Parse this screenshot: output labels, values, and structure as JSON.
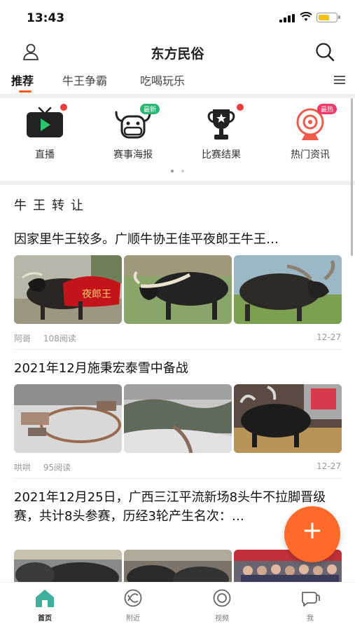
{
  "status_bar": {
    "time": "13:43"
  },
  "header": {
    "title": "东方民俗",
    "user_icon": "user-icon",
    "search_icon": "search-icon"
  },
  "tabs": [
    {
      "label": "推荐",
      "active": true
    },
    {
      "label": "牛王争霸",
      "active": false
    },
    {
      "label": "吃喝玩乐",
      "active": false
    }
  ],
  "quick_actions": [
    {
      "label": "直播",
      "icon": "tv-icon",
      "badge": ""
    },
    {
      "label": "赛事海报",
      "icon": "bull-icon",
      "badge": "最新"
    },
    {
      "label": "比赛结果",
      "icon": "trophy-icon",
      "badge": ""
    },
    {
      "label": "热门资讯",
      "icon": "webcam-icon",
      "badge": "最热"
    }
  ],
  "section": {
    "title": "牛王转让"
  },
  "articles": [
    {
      "title": "因家里牛王较多。广顺牛协王佳平夜郎王牛王…",
      "author": "阿哥",
      "reads": "108阅读",
      "date": "12-27",
      "banner_text": "夜郎王"
    },
    {
      "title": "2021年12月施秉宏泰雪中备战",
      "author": "哄哄",
      "reads": "95阅读",
      "date": "12-27"
    },
    {
      "title": "2021年12月25日，广西三江平流新场8头牛不拉脚晋级赛，共计8头参赛，历经3轮产生名次：…",
      "author": "",
      "reads": "",
      "date": ""
    }
  ],
  "fab": {
    "label": "+"
  },
  "bottom_nav": [
    {
      "label": "首页",
      "icon": "home-icon",
      "active": true
    },
    {
      "label": "附近",
      "icon": "nearby-icon",
      "active": false
    },
    {
      "label": "视频",
      "icon": "video-icon",
      "active": false
    },
    {
      "label": "我",
      "icon": "chat-icon",
      "active": false
    }
  ],
  "colors": {
    "accent": "#ff5a1f",
    "fab": "#ff6a2b",
    "badge_green": "#2bb673",
    "badge_red": "#f23a6a",
    "dot": "#f23a3a"
  }
}
